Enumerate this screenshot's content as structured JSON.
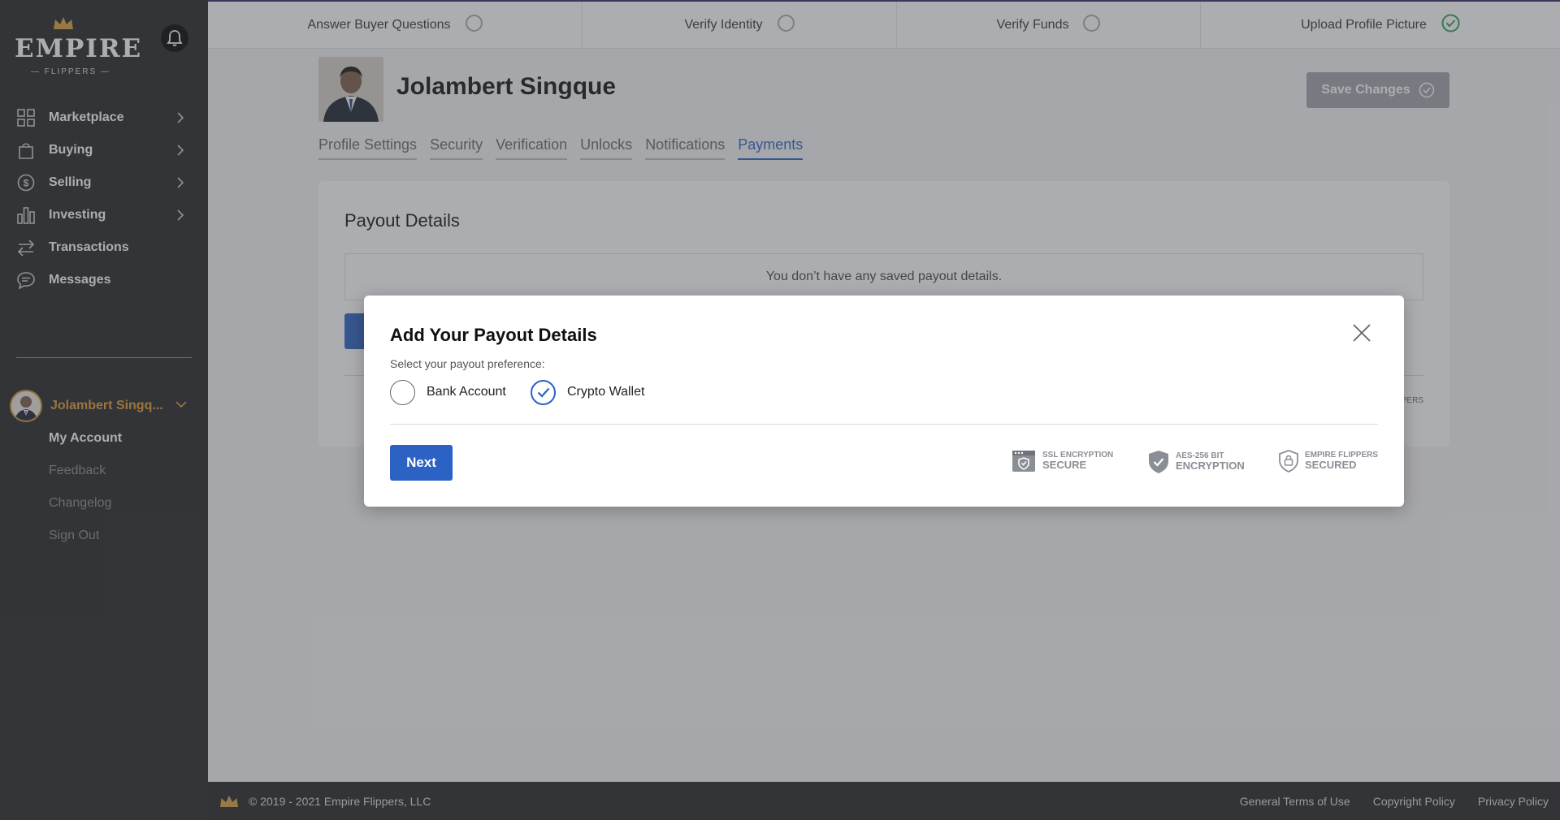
{
  "brand": {
    "logo_word": "EMPIRE",
    "logo_sub": "— FLIPPERS —",
    "crown_color": "#d9a13c"
  },
  "sidebar": {
    "items": [
      {
        "label": "Marketplace",
        "icon": "grid-icon",
        "has_chevron": true
      },
      {
        "label": "Buying",
        "icon": "shopping-bag-icon",
        "has_chevron": true
      },
      {
        "label": "Selling",
        "icon": "dollar-circle-icon",
        "has_chevron": true
      },
      {
        "label": "Investing",
        "icon": "bar-chart-icon",
        "has_chevron": true
      },
      {
        "label": "Transactions",
        "icon": "transfer-arrows-icon",
        "has_chevron": false
      },
      {
        "label": "Messages",
        "icon": "chat-bubble-icon",
        "has_chevron": false
      }
    ],
    "user": {
      "name": "Jolambert Singq..."
    },
    "submenu": [
      "My Account",
      "Feedback",
      "Changelog",
      "Sign Out"
    ]
  },
  "steps": [
    {
      "label": "Answer Buyer Questions",
      "done": false
    },
    {
      "label": "Verify Identity",
      "done": false
    },
    {
      "label": "Verify Funds",
      "done": false
    },
    {
      "label": "Upload Profile Picture",
      "done": true
    }
  ],
  "profile": {
    "name": "Jolambert Singque",
    "save_label": "Save Changes"
  },
  "tabs": [
    {
      "label": "Profile Settings",
      "active": false
    },
    {
      "label": "Security",
      "active": false
    },
    {
      "label": "Verification",
      "active": false
    },
    {
      "label": "Unlocks",
      "active": false
    },
    {
      "label": "Notifications",
      "active": false
    },
    {
      "label": "Payments",
      "active": true
    }
  ],
  "payout_card": {
    "title": "Payout Details",
    "empty_message": "You don’t have any saved payout details.",
    "trailing_text": "PERS"
  },
  "modal": {
    "title": "Add Your Payout Details",
    "subtitle": "Select your payout preference:",
    "options": [
      {
        "label": "Bank Account",
        "checked": false
      },
      {
        "label": "Crypto Wallet",
        "checked": true
      }
    ],
    "next_label": "Next",
    "badges": [
      {
        "small": "SSL ENCRYPTION",
        "big": "SECURE",
        "icon": "browser-shield-icon"
      },
      {
        "small": "AES-256 BIT",
        "big": "ENCRYPTION",
        "icon": "shield-check-icon"
      },
      {
        "small": "EMPIRE FLIPPERS",
        "big": "SECURED",
        "icon": "lock-shield-icon"
      }
    ]
  },
  "footer": {
    "copyright": "© 2019 - 2021 Empire Flippers, LLC",
    "links": [
      "General Terms of Use",
      "Copyright Policy",
      "Privacy Policy"
    ]
  },
  "colors": {
    "accent": "#2b62c4",
    "user_name": "#e09a38",
    "sidebar_bg": "#232323",
    "success": "#2e9e55"
  }
}
